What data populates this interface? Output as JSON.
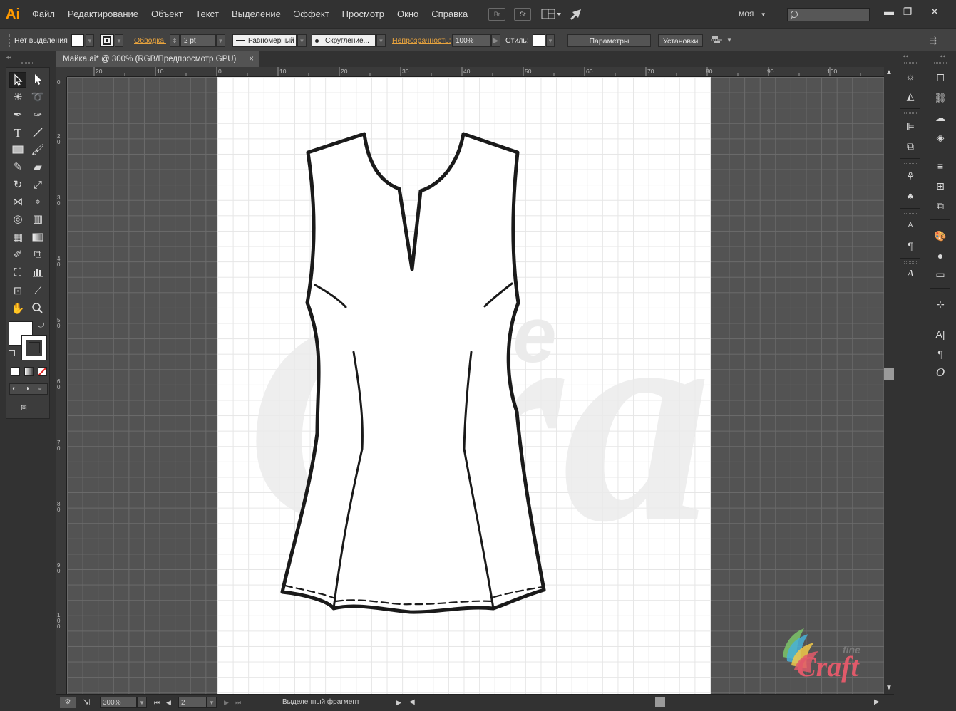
{
  "app": {
    "logo": "Ai"
  },
  "menu": [
    "Файл",
    "Редактирование",
    "Объект",
    "Текст",
    "Выделение",
    "Эффект",
    "Просмотр",
    "Окно",
    "Справка"
  ],
  "menubar_icons": {
    "bridge": "Br",
    "stock": "St"
  },
  "workspace": "моя",
  "window_controls": {
    "minimize": "▬",
    "maximize": "❐",
    "close": "✕"
  },
  "control_bar": {
    "selection_status": "Нет выделения",
    "stroke_label": "Обводка:",
    "stroke_weight": "2 pt",
    "profile": "Равномерный",
    "brush": "Скругление...",
    "opacity_label": "Непрозрачность:",
    "opacity_value": "100%",
    "style_label": "Стиль:",
    "doc_settings_button": "Параметры документа",
    "preferences_button": "Установки"
  },
  "document_tab": {
    "title": "Майка.ai* @ 300% (RGB/Предпросмотр GPU)",
    "close": "×"
  },
  "ruler_top": [
    "20",
    "10",
    "0",
    "10",
    "20",
    "30",
    "40",
    "50",
    "60",
    "70",
    "80",
    "90",
    "100"
  ],
  "ruler_left": [
    "0",
    "2 0",
    "3 0",
    "4 0",
    "5 0",
    "6 0",
    "7 0",
    "8 0",
    "9 0",
    "1 0 0"
  ],
  "status_bar": {
    "zoom": "300%",
    "artboard_number": "2",
    "status_text": "Выделенный фрагмент"
  },
  "watermark": {
    "brand_small": "fine",
    "brand_large": "Craft"
  },
  "colors": {
    "ui_dark": "#323232",
    "panel": "#424242",
    "canvas": "#535353",
    "accent_orange": "#ff9a00",
    "stroke_label": "#e8a33d",
    "logo_pink": "#e05a6a"
  }
}
